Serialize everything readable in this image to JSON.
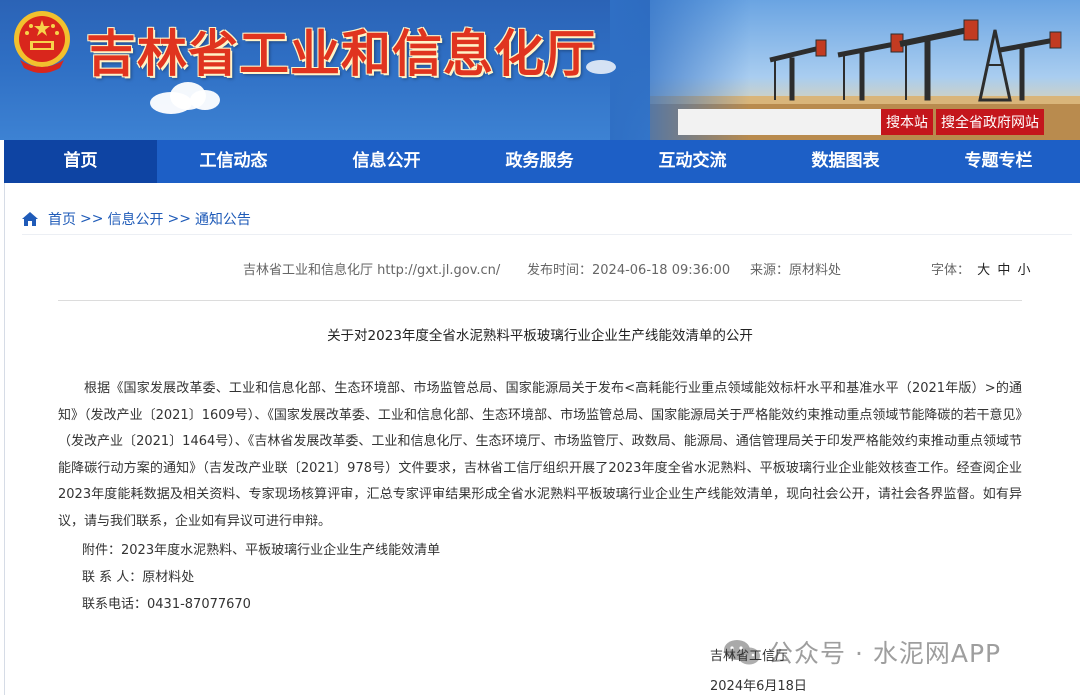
{
  "header": {
    "site_title": "吉林省工业和信息化厅",
    "search": {
      "placeholder": "",
      "site_button": "搜本站",
      "province_button": "搜全省政府网站"
    }
  },
  "nav": {
    "items": [
      {
        "label": "首页"
      },
      {
        "label": "工信动态"
      },
      {
        "label": "信息公开"
      },
      {
        "label": "政务服务"
      },
      {
        "label": "互动交流"
      },
      {
        "label": "数据图表"
      },
      {
        "label": "专题专栏"
      }
    ]
  },
  "breadcrumb": {
    "items": [
      "首页",
      "信息公开",
      "通知公告"
    ],
    "separator": ">>"
  },
  "meta": {
    "site": "吉林省工业和信息化厅 http://gxt.jl.gov.cn/",
    "publish_label": "发布时间：",
    "publish_time": "2024-06-18 09:36:00",
    "source_label": "来源：",
    "source": "原材料处",
    "font_label": "字体：",
    "font_sizes": [
      "大",
      "中",
      "小"
    ]
  },
  "article": {
    "title": "关于对2023年度全省水泥熟料平板玻璃行业企业生产线能效清单的公开",
    "body": "根据《国家发展改革委、工业和信息化部、生态环境部、市场监管总局、国家能源局关于发布<高耗能行业重点领域能效标杆水平和基准水平（2021年版）>的通知》（发改产业〔2021〕1609号）、《国家发展改革委、工业和信息化部、生态环境部、市场监管总局、国家能源局关于严格能效约束推动重点领域节能降碳的若干意见》（发改产业〔2021〕1464号）、《吉林省发展改革委、工业和信息化厅、生态环境厅、市场监管厅、政数局、能源局、通信管理局关于印发严格能效约束推动重点领域节能降碳行动方案的通知》（吉发改产业联〔2021〕978号）文件要求，吉林省工信厅组织开展了2023年度全省水泥熟料、平板玻璃行业企业能效核查工作。经查阅企业2023年度能耗数据及相关资料、专家现场核算评审，汇总专家评审结果形成全省水泥熟料平板玻璃行业企业生产线能效清单，现向社会公开，请社会各界监督。如有异议，请与我们联系，企业如有异议可进行申辩。",
    "attachment": "附件：2023年度水泥熟料、平板玻璃行业企业生产线能效清单",
    "contact_person": "联 系 人：原材料处",
    "contact_phone": "联系电话：0431-87077670",
    "sign_org": "吉林省工信厅",
    "sign_date": "2024年6月18日"
  },
  "watermark": {
    "text": "公众号 · 水泥网APP",
    "icon": "wechat-icon"
  },
  "colors": {
    "nav_bg": "#1d5fc6",
    "nav_active": "#0e44a3",
    "title_red": "#e0341f",
    "button_red": "#c4161c",
    "link_blue": "#1f5bb8"
  }
}
